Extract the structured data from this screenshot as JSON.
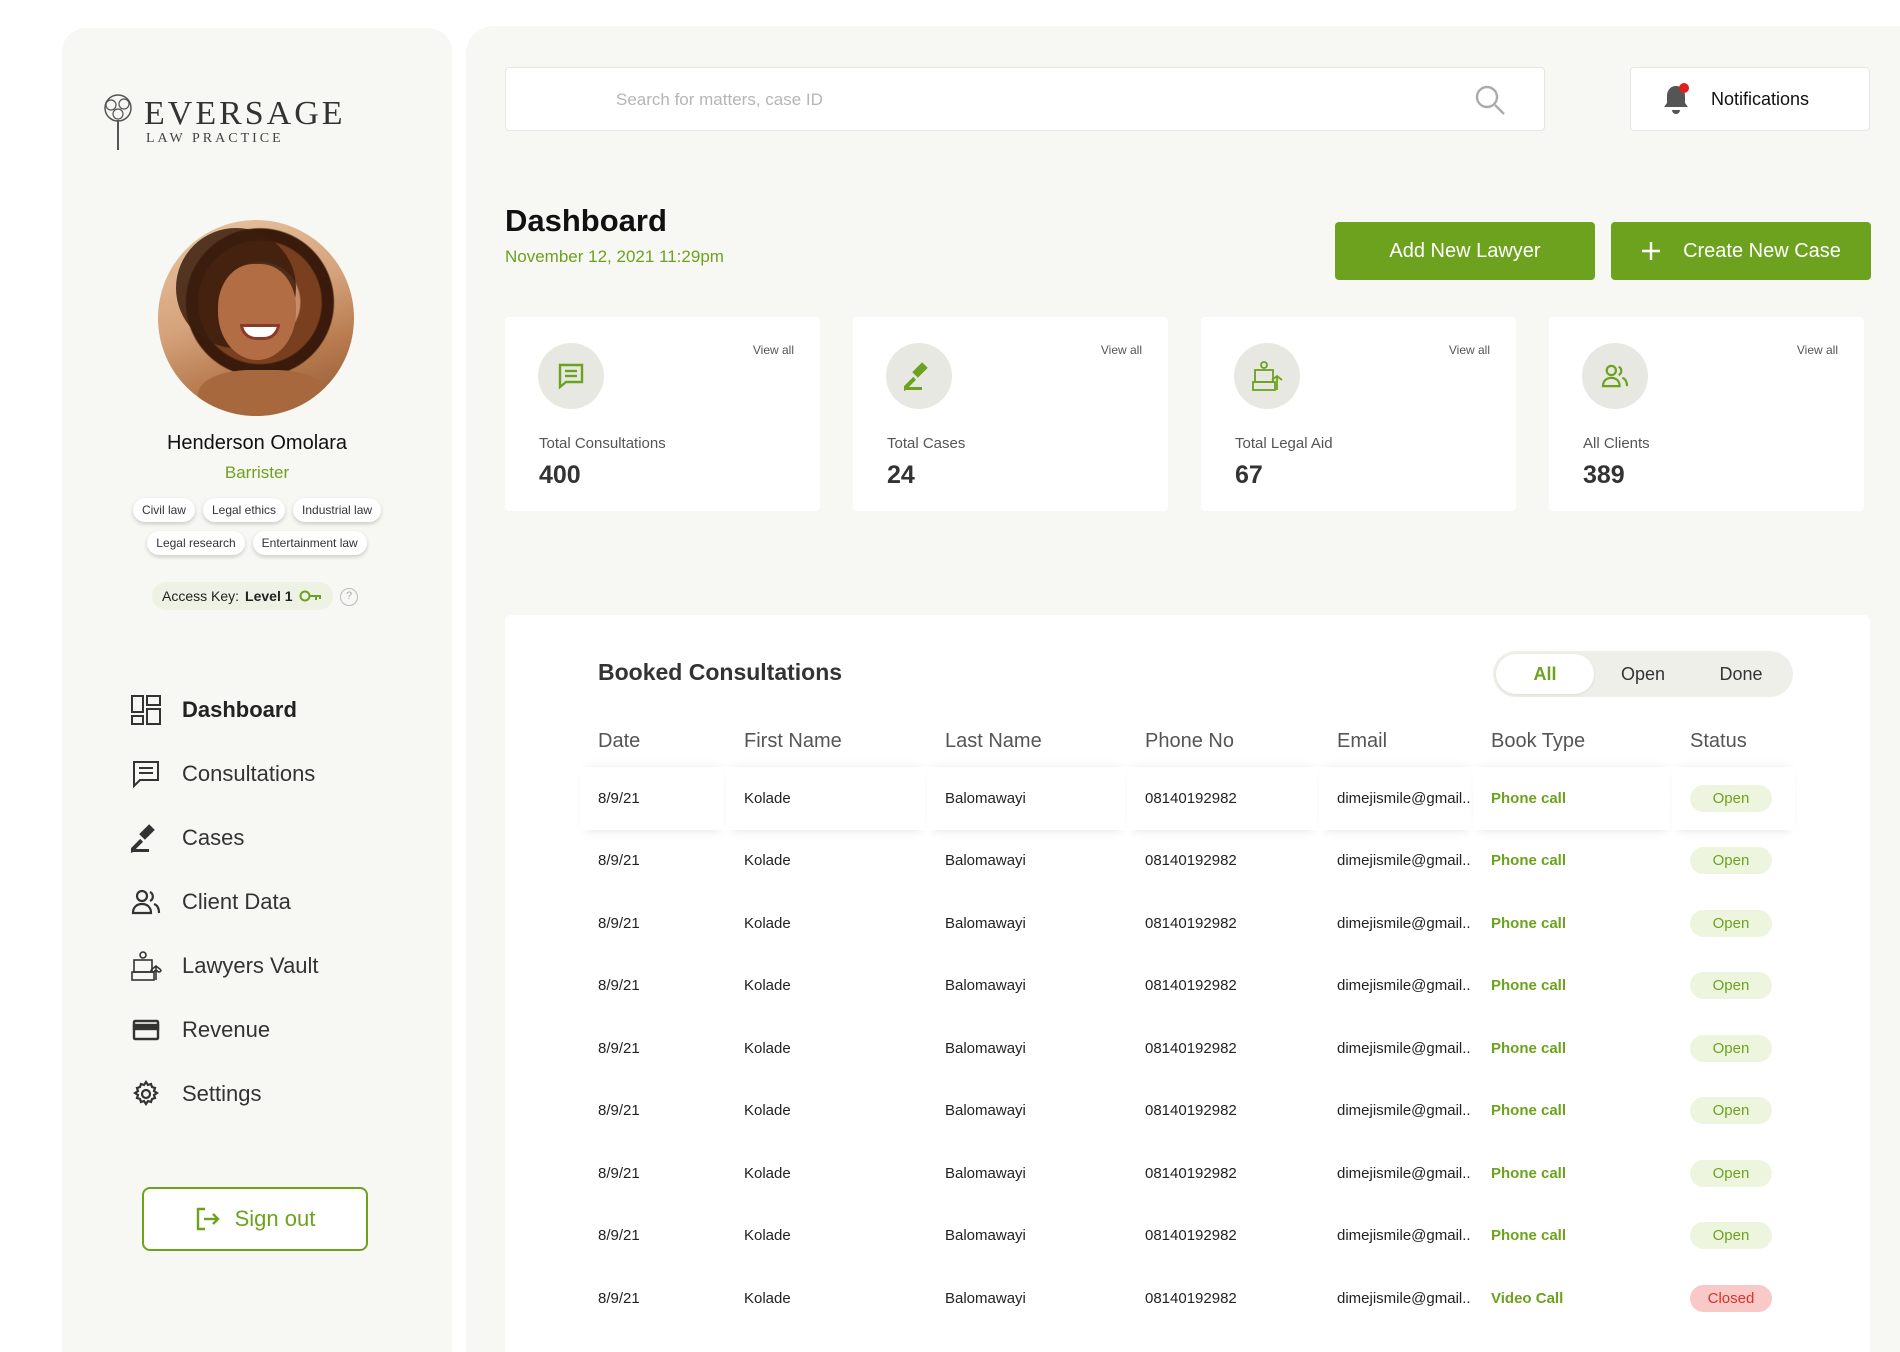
{
  "brand": {
    "name": "EVERSAGE",
    "subtitle": "LAW PRACTICE"
  },
  "profile": {
    "name": "Henderson Omolara",
    "role": "Barrister",
    "tags": [
      "Civil law",
      "Legal ethics",
      "Industrial law",
      "Legal research",
      "Entertainment law"
    ],
    "access_label": "Access Key:",
    "access_level": "Level 1"
  },
  "nav": [
    {
      "label": "Dashboard",
      "icon": "dashboard-icon",
      "active": true
    },
    {
      "label": "Consultations",
      "icon": "chat-icon",
      "active": false
    },
    {
      "label": "Cases",
      "icon": "gavel-icon",
      "active": false
    },
    {
      "label": "Client Data",
      "icon": "people-icon",
      "active": false
    },
    {
      "label": "Lawyers Vault",
      "icon": "vault-icon",
      "active": false
    },
    {
      "label": "Revenue",
      "icon": "card-icon",
      "active": false
    },
    {
      "label": "Settings",
      "icon": "gear-icon",
      "active": false
    }
  ],
  "signout_label": "Sign out",
  "search": {
    "placeholder": "Search for matters, case ID"
  },
  "notifications_label": "Notifications",
  "header": {
    "title": "Dashboard",
    "date": "November 12, 2021 11:29pm",
    "add_lawyer_label": "Add New Lawyer",
    "create_case_label": "Create New Case"
  },
  "stats": [
    {
      "label": "Total Consultations",
      "value": "400",
      "view_all": "View all",
      "icon": "chat-icon"
    },
    {
      "label": "Total Cases",
      "value": "24",
      "view_all": "View all",
      "icon": "gavel-icon"
    },
    {
      "label": "Total Legal Aid",
      "value": "67",
      "view_all": "View all",
      "icon": "legal-aid-icon"
    },
    {
      "label": "All Clients",
      "value": "389",
      "view_all": "View all",
      "icon": "people-icon"
    }
  ],
  "consultations": {
    "title": "Booked Consultations",
    "filters": [
      "All",
      "Open",
      "Done"
    ],
    "active_filter": "All",
    "columns": [
      "Date",
      "First Name",
      "Last Name",
      "Phone No",
      "Email",
      "Book Type",
      "Status"
    ],
    "rows": [
      [
        "8/9/21",
        "Kolade",
        "Balomawayi",
        "08140192982",
        "dimejismile@gmail..",
        "Phone call",
        "Open"
      ],
      [
        "8/9/21",
        "Kolade",
        "Balomawayi",
        "08140192982",
        "dimejismile@gmail..",
        "Phone call",
        "Open"
      ],
      [
        "8/9/21",
        "Kolade",
        "Balomawayi",
        "08140192982",
        "dimejismile@gmail..",
        "Phone call",
        "Open"
      ],
      [
        "8/9/21",
        "Kolade",
        "Balomawayi",
        "08140192982",
        "dimejismile@gmail..",
        "Phone call",
        "Open"
      ],
      [
        "8/9/21",
        "Kolade",
        "Balomawayi",
        "08140192982",
        "dimejismile@gmail..",
        "Phone call",
        "Open"
      ],
      [
        "8/9/21",
        "Kolade",
        "Balomawayi",
        "08140192982",
        "dimejismile@gmail..",
        "Phone call",
        "Open"
      ],
      [
        "8/9/21",
        "Kolade",
        "Balomawayi",
        "08140192982",
        "dimejismile@gmail..",
        "Phone call",
        "Open"
      ],
      [
        "8/9/21",
        "Kolade",
        "Balomawayi",
        "08140192982",
        "dimejismile@gmail..",
        "Phone call",
        "Open"
      ],
      [
        "8/9/21",
        "Kolade",
        "Balomawayi",
        "08140192982",
        "dimejismile@gmail..",
        "Video Call",
        "Closed"
      ]
    ]
  },
  "colors": {
    "accent": "#6da21f",
    "closed": "#d6332b",
    "background": "#f7f7f3"
  }
}
